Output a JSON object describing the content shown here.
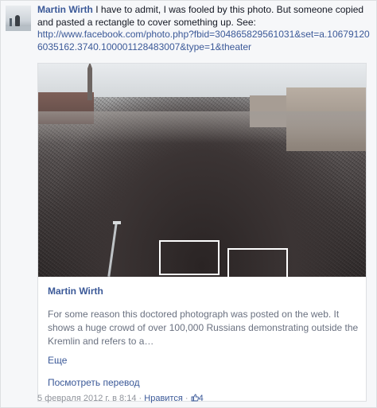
{
  "comment": {
    "author": "Martin Wirth",
    "text": " I have to admit, I was fooled by this photo. But someone copied and pasted a rectangle to cover something up. See:",
    "link": "http://www.facebook.com/photo.php?fbid=304865829561031&set=a.106791206035162.3740.100001128483007&type=1&theater"
  },
  "share": {
    "title": "Martin Wirth",
    "description": "For some reason this doctored photograph was posted on the web. It shows a huge crowd of over 100,000 Russians demonstrating outside the Kremlin and refers to a…",
    "more": "Еще",
    "translate": "Посмотреть перевод"
  },
  "footer": {
    "date": "5 февраля 2012 г. в 8:14",
    "sep1": " · ",
    "like": "Нравится",
    "sep2": " · ",
    "count": "4"
  },
  "colors": {
    "link": "#3b5998",
    "muted": "#90949c"
  }
}
